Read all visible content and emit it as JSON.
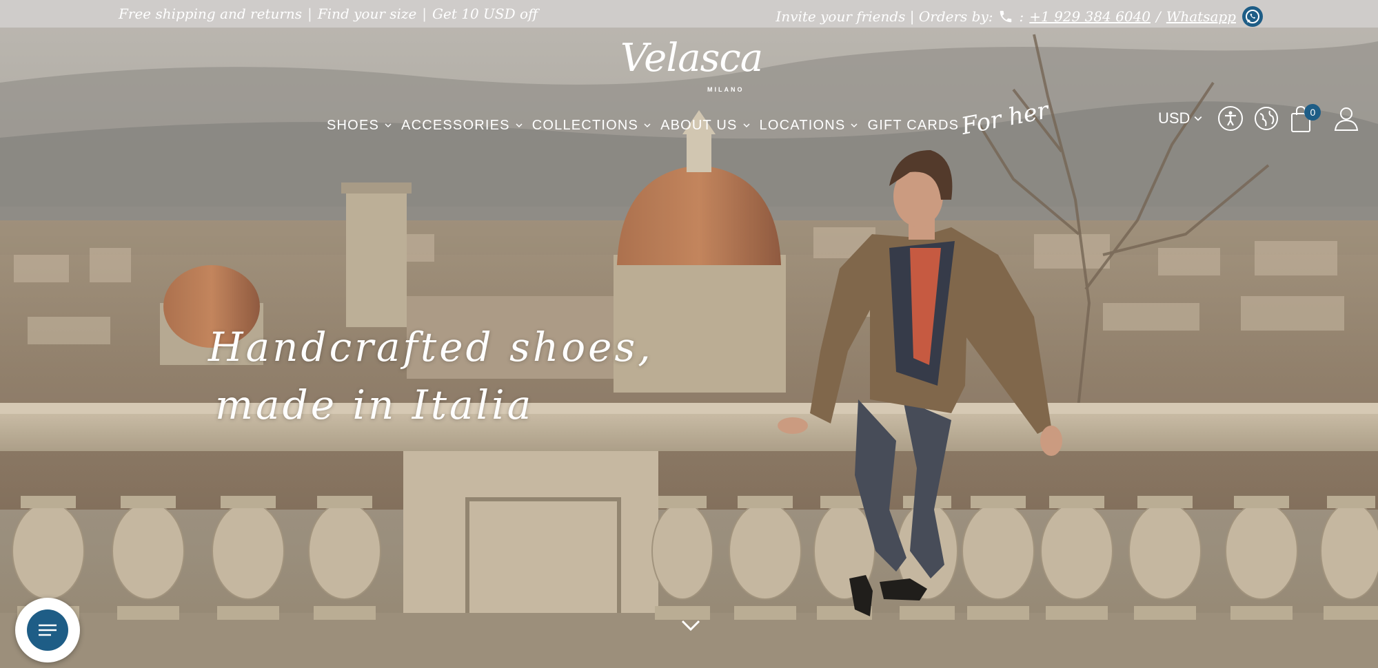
{
  "topbar": {
    "left": [
      "Free shipping and returns",
      "Find your size",
      "Get 10 USD off"
    ],
    "separator": "|",
    "invite": "Invite your friends | Orders by:",
    "phone_prefix": ":",
    "phone": "+1 929 384 6040",
    "whatsapp_prefix": "/",
    "whatsapp": "Whatsapp",
    "icons": [
      "phone-icon",
      "whatsapp-icon"
    ]
  },
  "header": {
    "logo": "Velasca",
    "logo_sub": "MILANO",
    "nav": [
      {
        "label": "SHOES",
        "dropdown": true
      },
      {
        "label": "ACCESSORIES",
        "dropdown": true
      },
      {
        "label": "COLLECTIONS",
        "dropdown": true
      },
      {
        "label": "ABOUT US",
        "dropdown": true
      },
      {
        "label": "LOCATIONS",
        "dropdown": true
      },
      {
        "label": "GIFT CARDS",
        "dropdown": false
      }
    ],
    "for_her": "For her",
    "currency": "USD",
    "cart_count": "0",
    "icons": [
      "accessibility-icon",
      "globe-icon",
      "bag-icon",
      "user-icon"
    ]
  },
  "hero": {
    "tagline_line1": "Handcrafted shoes,",
    "tagline_line2": "made in Italia"
  },
  "colors": {
    "topbar_bg": "#cfccca",
    "badge": "#1e5d86",
    "chat": "#1e5d86",
    "text": "#ffffff"
  }
}
